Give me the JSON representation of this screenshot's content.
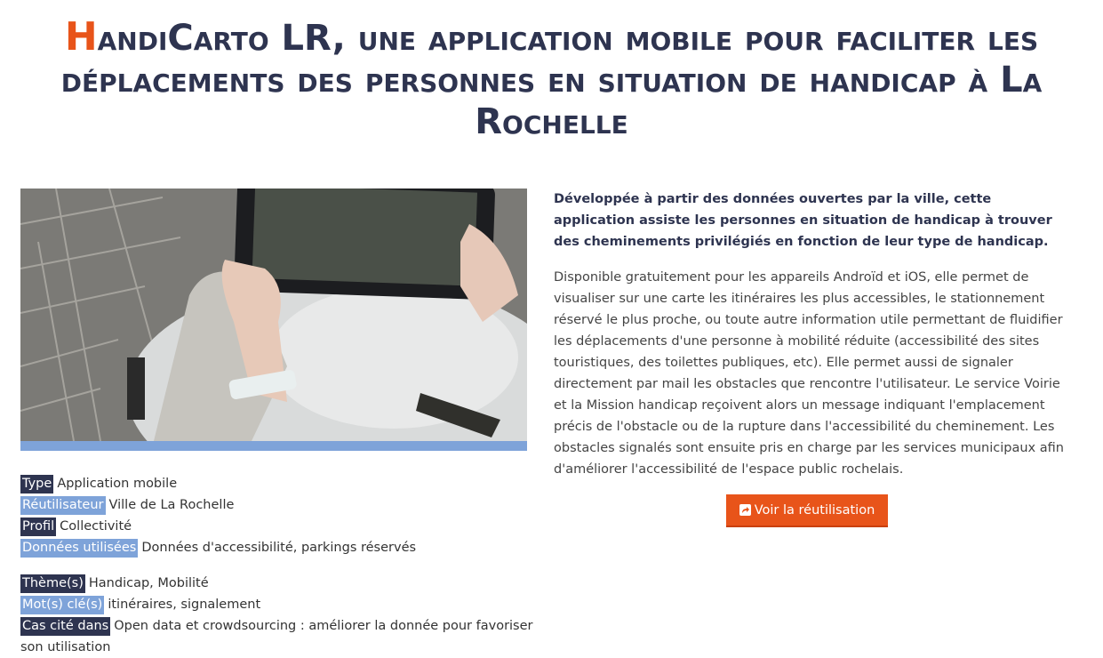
{
  "page": {
    "title_first": "H",
    "title_rest": "andiCarto LR, une application mobile pour faciliter les déplacements des personnes en situation de handicap à La Rochelle"
  },
  "photo": {
    "icon": "tablet-photo"
  },
  "meta": {
    "type_label": "Type",
    "type_value": "Application mobile",
    "reuser_label": "Réutilisateur",
    "reuser_value": "Ville de La Rochelle",
    "profile_label": "Profil",
    "profile_value": "Collectivité",
    "data_label": "Données utilisées",
    "data_value": "Données d'accessibilité, parkings réservés",
    "themes_label": "Thème(s)",
    "themes_value": "Handicap, Mobilité",
    "keywords_label": "Mot(s) clé(s)",
    "keywords_value": "itinéraires, signalement",
    "cited_label": "Cas cité dans",
    "cited_value": "Open data et crowdsourcing : améliorer la donnée pour favoriser son utilisation"
  },
  "description": {
    "lead": "Développée à partir des données ouvertes par la ville, cette application assiste les personnes en situation de handicap à trouver des cheminements privilégiés en fonction de leur type de handicap.",
    "body": "Disponible gratuitement pour les appareils Androïd et iOS, elle permet de visualiser sur une carte les itinéraires les plus accessibles, le stationnement réservé le plus proche, ou toute autre information utile permettant de fluidifier les déplacements d'une personne à mobilité réduite (accessibilité des sites touristiques, des toilettes publiques, etc). Elle permet aussi de signaler directement par mail les obstacles que rencontre l'utilisateur. Le service Voirie et la Mission handicap reçoivent alors un message indiquant l'emplacement précis de l'obstacle ou de la rupture dans l'accessibilité du cheminement. Les obstacles signalés sont ensuite pris en charge par les services municipaux afin d'améliorer l'accessibilité de l'espace public rochelais."
  },
  "action": {
    "label": "Voir la réutilisation",
    "icon": "share-icon"
  },
  "colors": {
    "accent": "#e8541a",
    "navy": "#2e3450",
    "light_blue": "#7ea3d9"
  }
}
